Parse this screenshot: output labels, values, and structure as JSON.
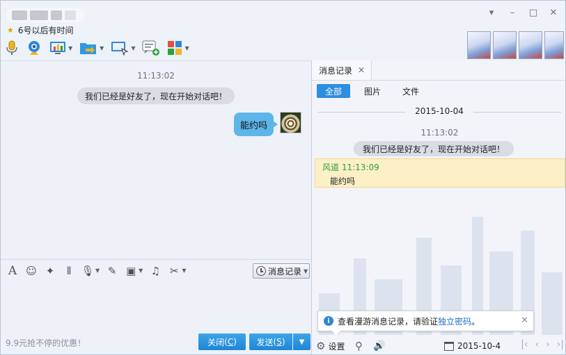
{
  "window": {
    "status_text": "6号以后有时间",
    "controls": {
      "dropdown_icon": "▾",
      "minimize_icon": "–",
      "maximize_icon": "□",
      "close_icon": "✕"
    }
  },
  "toolbar": {
    "items": [
      "voice-call",
      "video-call",
      "remote-desktop",
      "file-transfer",
      "screen-share",
      "create-group",
      "apps"
    ]
  },
  "chat": {
    "timestamp": "11:13:02",
    "system_message": "我们已经是好友了，现在开始对话吧！",
    "my_message": "能约吗"
  },
  "editor_toolbar": {
    "history_button_label": "消息记录"
  },
  "footer": {
    "promo_text": "9.9元抢不停的优惠！",
    "close_label": "关闭",
    "close_shortcut": "C",
    "send_label": "发送",
    "send_shortcut": "S"
  },
  "history": {
    "tab_label": "消息记录",
    "filters": [
      "全部",
      "图片",
      "文件"
    ],
    "date": "2015-10-04",
    "timestamp": "11:13:02",
    "system_message": "我们已经是好友了，现在开始对话吧！",
    "highlight_sender": "风道",
    "highlight_time": "11:13:09",
    "highlight_message": "能约吗",
    "notice_text": "查看漫游消息记录，请验证",
    "notice_link": "独立密码",
    "notice_end": "。",
    "settings_label": "设置",
    "bottom_date": "2015-10-4"
  },
  "colors": {
    "accent": "#2e8ee0",
    "bubble": "#5db6ea",
    "highlight_bg": "#fdf0c6",
    "sender_green": "#2aa03a"
  }
}
